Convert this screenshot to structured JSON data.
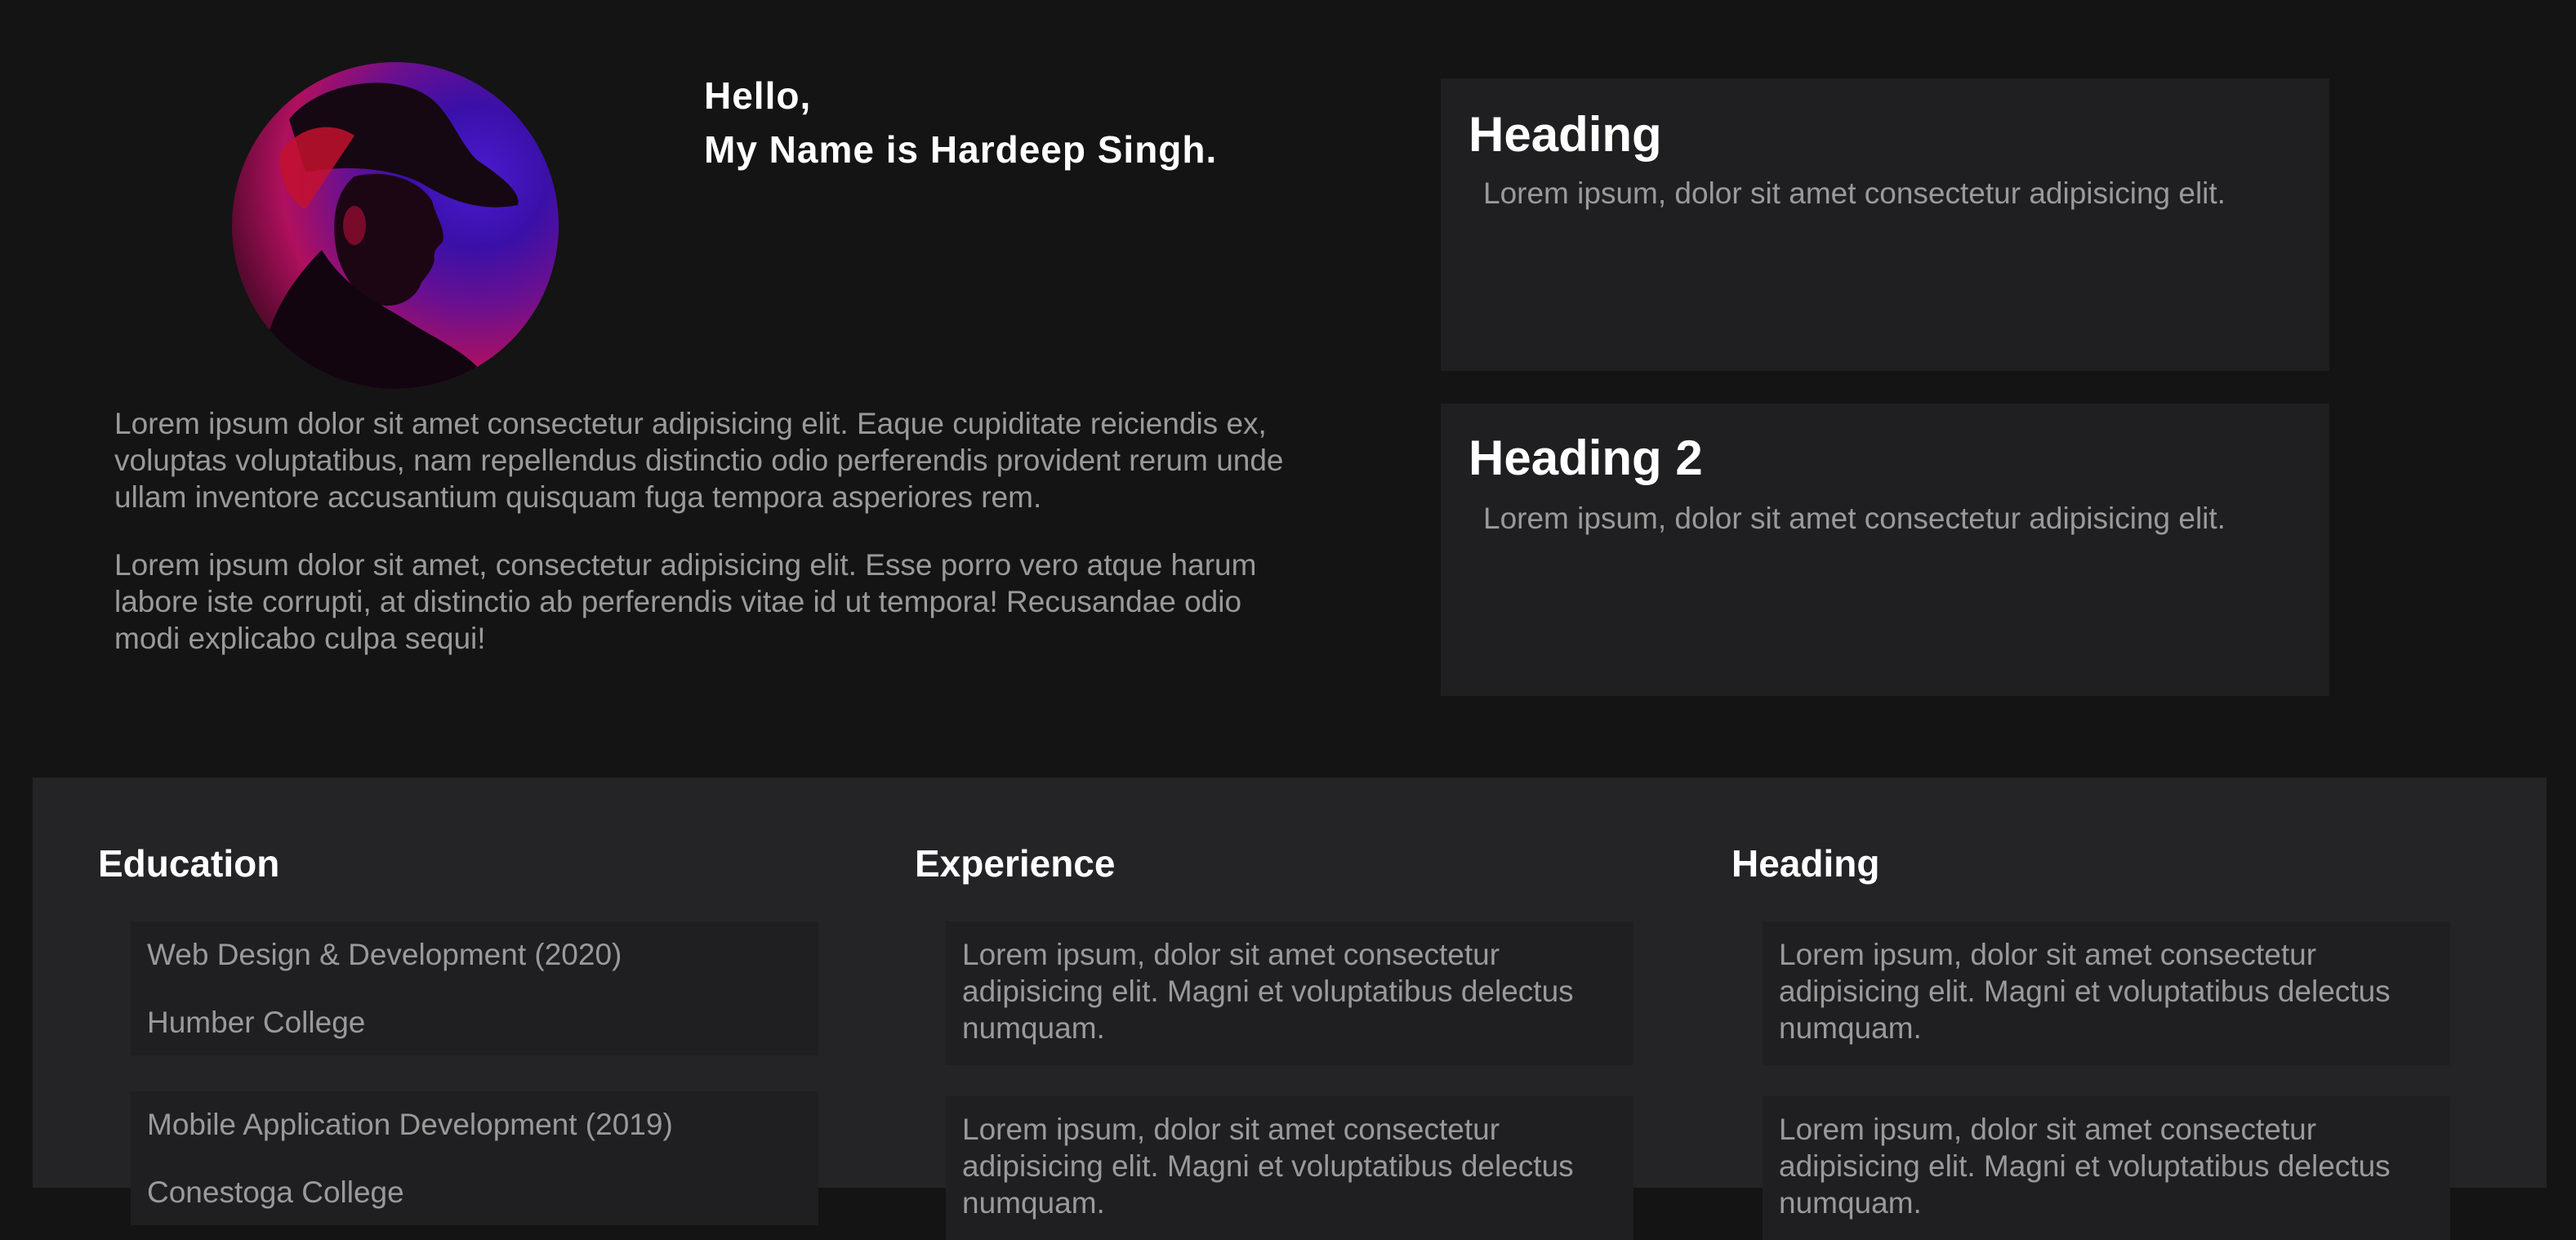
{
  "hero": {
    "greeting_line1": "Hello,",
    "greeting_line2": "My Name is Hardeep Singh.",
    "bio_paragraphs": [
      "Lorem ipsum dolor sit amet consectetur adipisicing elit. Eaque cupiditate reiciendis ex, voluptas voluptatibus, nam repellendus distinctio odio perferendis provident rerum unde ullam inventore accusantium quisquam fuga tempora asperiores rem.",
      "Lorem ipsum dolor sit amet, consectetur adipisicing elit. Esse porro vero atque harum labore iste corrupti, at distinctio ab perferendis vitae id ut tempora! Recusandae odio modi explicabo culpa sequi!"
    ]
  },
  "cards": [
    {
      "heading": "Heading",
      "text": "Lorem ipsum, dolor sit amet consectetur adipisicing elit."
    },
    {
      "heading": "Heading 2",
      "text": "Lorem ipsum, dolor sit amet consectetur adipisicing elit."
    }
  ],
  "sections": {
    "education": {
      "title": "Education",
      "items": [
        {
          "line1": "Web Design & Development (2020)",
          "line2": "Humber College"
        },
        {
          "line1": "Mobile Application Development (2019)",
          "line2": "Conestoga College"
        }
      ]
    },
    "experience": {
      "title": "Experience",
      "items": [
        {
          "text": "Lorem ipsum, dolor sit amet consectetur adipisicing elit. Magni et voluptatibus delectus numquam."
        },
        {
          "text": "Lorem ipsum, dolor sit amet consectetur adipisicing elit. Magni et voluptatibus delectus numquam."
        }
      ]
    },
    "other": {
      "title": "Heading",
      "items": [
        {
          "text": "Lorem ipsum, dolor sit amet consectetur adipisicing elit. Magni et voluptatibus delectus numquam."
        },
        {
          "text": "Lorem ipsum, dolor sit amet consectetur adipisicing elit. Magni et voluptatibus delectus numquam."
        }
      ]
    }
  },
  "colors": {
    "background": "#141414",
    "panel": "#242426",
    "card": "#1f1f21",
    "heading_text": "#ffffff",
    "body_text": "#9a9a9a"
  }
}
